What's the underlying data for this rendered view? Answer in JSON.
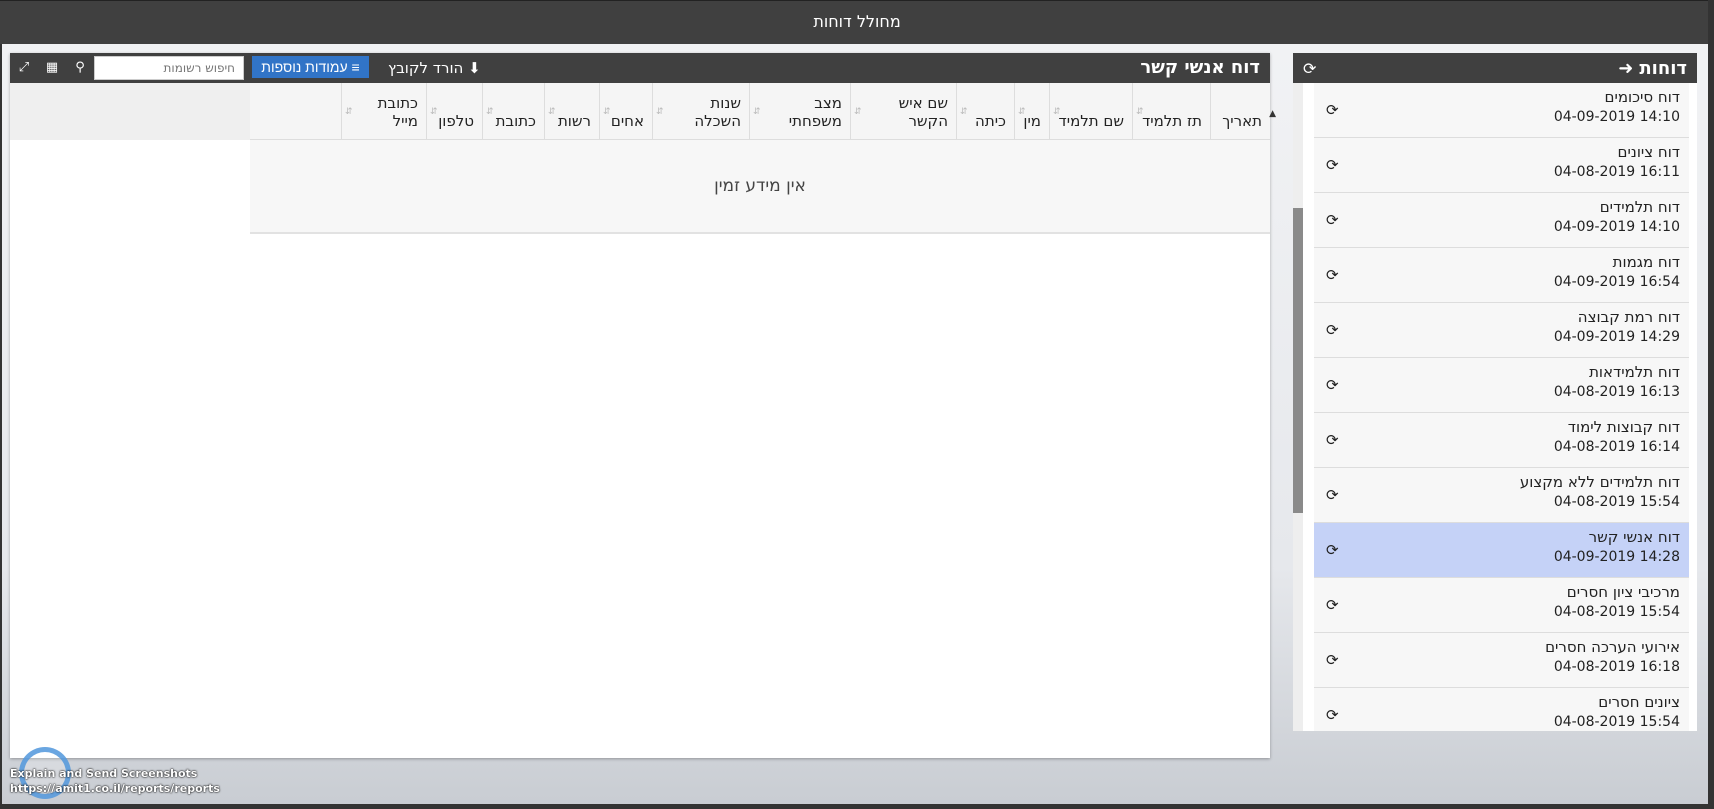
{
  "topbar": {
    "title": "מחולל דוחות"
  },
  "sidebar": {
    "title": "דוחות",
    "back_icon": "arrow-right-icon",
    "refresh_icon": "refresh-icon",
    "items": [
      {
        "name": "דוח סיכומים",
        "date": "14:10 04-09-2019",
        "active": false
      },
      {
        "name": "דוח ציונים",
        "date": "16:11 04-08-2019",
        "active": false
      },
      {
        "name": "דוח תלמידים",
        "date": "14:10 04-09-2019",
        "active": false
      },
      {
        "name": "דוח מגמות",
        "date": "16:54 04-09-2019",
        "active": false
      },
      {
        "name": "דוח רמת קבוצה",
        "date": "14:29 04-09-2019",
        "active": false
      },
      {
        "name": "דוח תלמידאות",
        "date": "16:13 04-08-2019",
        "active": false
      },
      {
        "name": "דוח קבוצות לימוד",
        "date": "16:14 04-08-2019",
        "active": false
      },
      {
        "name": "דוח תלמידים ללא מקצוע",
        "date": "15:54 04-08-2019",
        "active": false
      },
      {
        "name": "דוח אנשי קשר",
        "date": "14:28 04-09-2019",
        "active": true
      },
      {
        "name": "מרכיבי ציון חסרים",
        "date": "15:54 04-08-2019",
        "active": false
      },
      {
        "name": "אירועי הערכה חסרים",
        "date": "16:18 04-08-2019",
        "active": false
      },
      {
        "name": "ציונים חסרים",
        "date": "15:54 04-08-2019",
        "active": false
      }
    ]
  },
  "main": {
    "title": "דוח אנשי קשר",
    "download_label": "הורד לקובץ",
    "columns_label": "עמודות נוספות",
    "search_placeholder": "חיפוש רשומות",
    "columns": [
      "תאריך",
      "תז תלמיד",
      "שם תלמיד",
      "מין",
      "כיתה",
      "שם איש הקשר",
      "מצב משפחתי",
      "שנות השכלה",
      "אחים",
      "רשות",
      "כתובת",
      "טלפון",
      "כתובת מייל"
    ],
    "empty_text": "אין מידע זמין"
  },
  "overlay": {
    "title": "Explain and Send Screenshots",
    "url": "https://amit1.co.il/reports/reports"
  }
}
